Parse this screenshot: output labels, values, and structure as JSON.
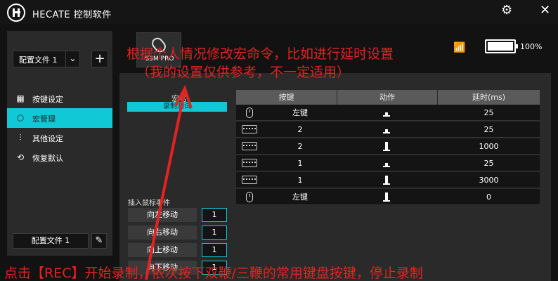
{
  "app": {
    "title": "HECATE 控制软件"
  },
  "window": {
    "settings_icon": "gear-icon",
    "close_icon": "close-icon"
  },
  "device": {
    "name": "S3M PRO",
    "battery": "100%",
    "battery_level": 1.0
  },
  "sidebar": {
    "profile_select": "配置文件 1",
    "add_label": "+",
    "items": [
      {
        "label": "按键设定",
        "icon": "keys-icon",
        "active": false
      },
      {
        "label": "宏管理",
        "icon": "macro-icon",
        "active": true
      },
      {
        "label": "其他设定",
        "icon": "sliders-icon",
        "active": false
      },
      {
        "label": "恢复默认",
        "icon": "restore-icon",
        "active": false
      }
    ],
    "profile_name": "配置文件 1"
  },
  "macro": {
    "title": "宏名",
    "item": "录制测试"
  },
  "table": {
    "headers": [
      "按键",
      "动作",
      "延时(ms)"
    ],
    "rows": [
      {
        "device": "mouse",
        "key": "左键",
        "action": "up",
        "delay": "25"
      },
      {
        "device": "keyboard",
        "key": "2",
        "action": "up",
        "delay": "25"
      },
      {
        "device": "keyboard",
        "key": "2",
        "action": "down",
        "delay": "1000"
      },
      {
        "device": "keyboard",
        "key": "1",
        "action": "up",
        "delay": "25"
      },
      {
        "device": "keyboard",
        "key": "1",
        "action": "down",
        "delay": "3000"
      },
      {
        "device": "mouse",
        "key": "左键",
        "action": "down",
        "delay": "0"
      }
    ]
  },
  "insert": {
    "label": "插入鼠标事件",
    "moves": [
      {
        "label": "向左移动",
        "value": "1"
      },
      {
        "label": "向右移动",
        "value": "1"
      },
      {
        "label": "向上移动",
        "value": "1"
      },
      {
        "label": "向下移动",
        "value": "1"
      }
    ]
  },
  "annotations": {
    "top_line1": "根据个人情况修改宏命令，比如进行延时设置",
    "top_line2": "（我的设置仅供参考，不一定适用）",
    "bottom": "点击【REC】开始录制，依次按下双鞭/三鞭的常用键盘按键，停止录制"
  },
  "colors": {
    "accent": "#11c9d6",
    "annotation": "#e52222"
  }
}
